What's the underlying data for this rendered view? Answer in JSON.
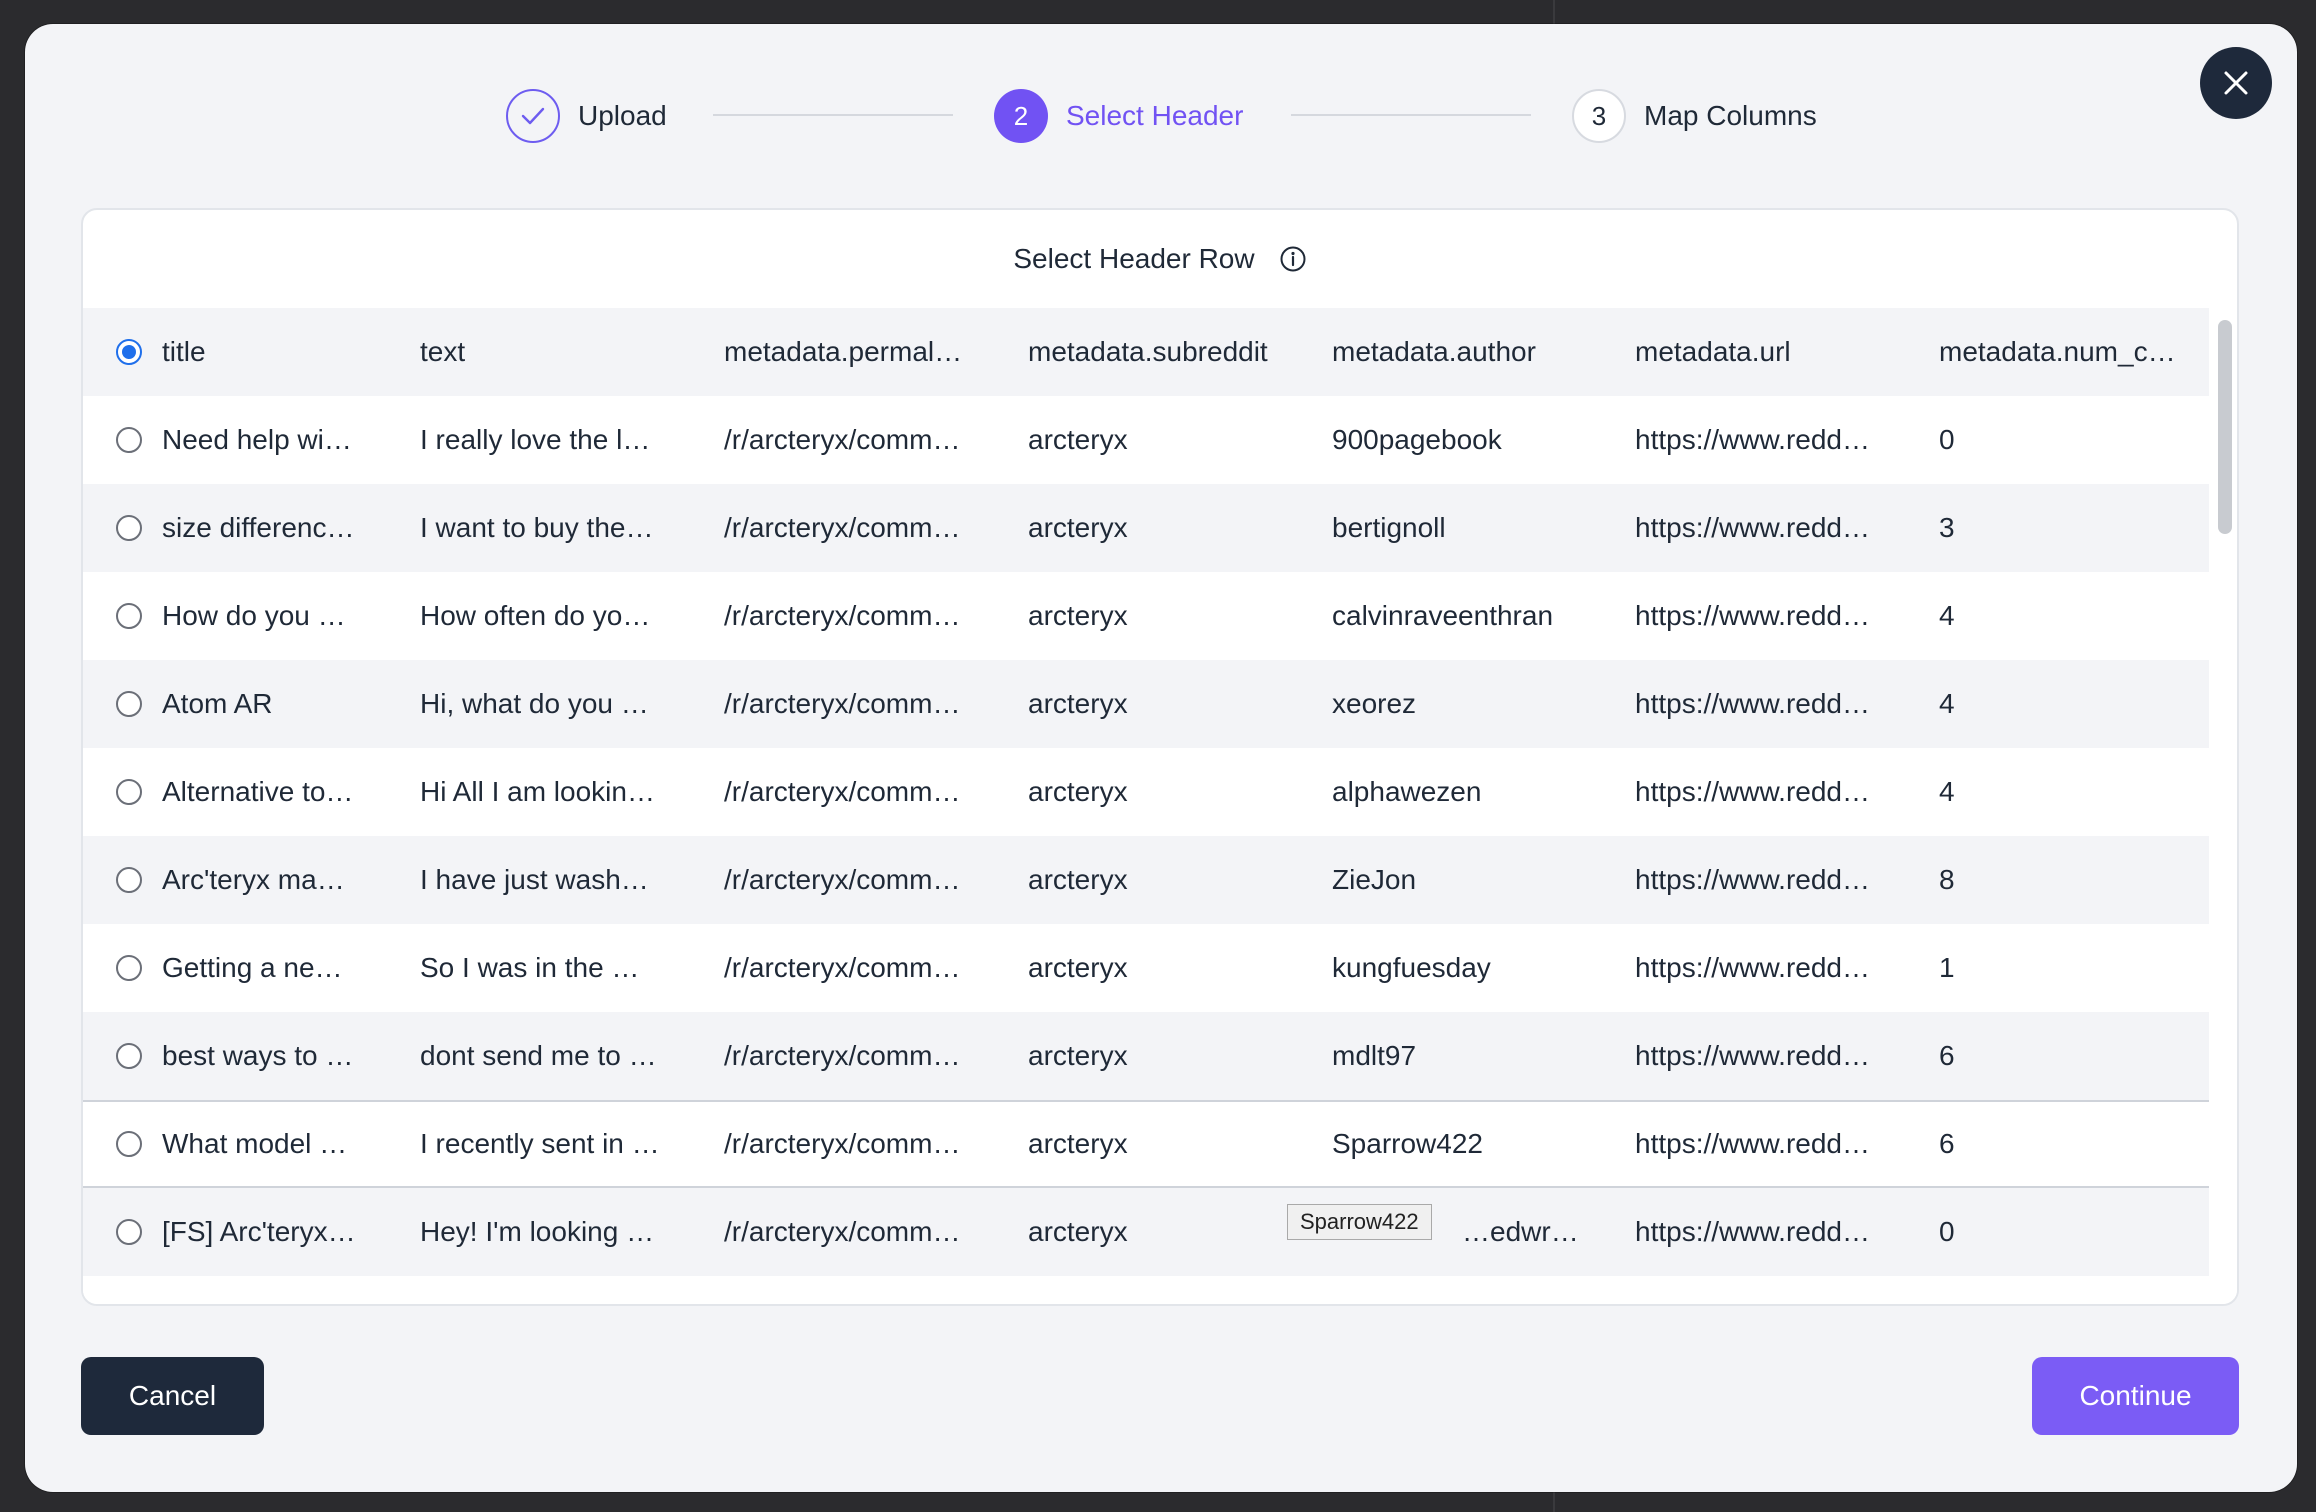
{
  "steps": [
    {
      "number": "1",
      "label": "Upload",
      "state": "done"
    },
    {
      "number": "2",
      "label": "Select Header",
      "state": "active"
    },
    {
      "number": "3",
      "label": "Map Columns",
      "state": "upcoming"
    }
  ],
  "panel": {
    "title": "Select Header Row"
  },
  "table": {
    "header": [
      "title",
      "text",
      "metadata.permal…",
      "metadata.subreddit",
      "metadata.author",
      "metadata.url",
      "metadata.num_c…"
    ],
    "rows": [
      [
        "Need help wi…",
        "I really love the l…",
        "/r/arcteryx/comm…",
        "arcteryx",
        "900pagebook",
        "https://www.redd…",
        "0"
      ],
      [
        "size differenc…",
        "I want to buy the…",
        "/r/arcteryx/comm…",
        "arcteryx",
        "bertignoll",
        "https://www.redd…",
        "3"
      ],
      [
        "How do you …",
        "How often do yo…",
        "/r/arcteryx/comm…",
        "arcteryx",
        "calvinraveenthran",
        "https://www.redd…",
        "4"
      ],
      [
        "Atom AR",
        "Hi, what do you …",
        "/r/arcteryx/comm…",
        "arcteryx",
        "xeorez",
        "https://www.redd…",
        "4"
      ],
      [
        "Alternative to…",
        "Hi All I am lookin…",
        "/r/arcteryx/comm…",
        "arcteryx",
        "alphawezen",
        "https://www.redd…",
        "4"
      ],
      [
        "Arc'teryx ma…",
        "I have just wash…",
        "/r/arcteryx/comm…",
        "arcteryx",
        "ZieJon",
        "https://www.redd…",
        "8"
      ],
      [
        "Getting a ne…",
        "So I was in the …",
        "/r/arcteryx/comm…",
        "arcteryx",
        "kungfuesday",
        "https://www.redd…",
        "1"
      ],
      [
        "best ways to …",
        "dont send me to …",
        "/r/arcteryx/comm…",
        "arcteryx",
        "mdlt97",
        "https://www.redd…",
        "6"
      ],
      [
        "What model …",
        "I recently sent in …",
        "/r/arcteryx/comm…",
        "arcteryx",
        "Sparrow422",
        "https://www.redd…",
        "6"
      ],
      [
        "[FS] Arc'teryx…",
        "Hey! I'm looking …",
        "/r/arcteryx/comm…",
        "arcteryx",
        "…edwriter",
        "https://www.redd…",
        "0"
      ]
    ]
  },
  "tooltip": {
    "text": "Sparrow422"
  },
  "actions": {
    "cancel_label": "Cancel",
    "continue_label": "Continue"
  },
  "colors": {
    "accent": "#7152f3",
    "dark": "#1e293b",
    "radio_checked": "#1f6feb"
  }
}
